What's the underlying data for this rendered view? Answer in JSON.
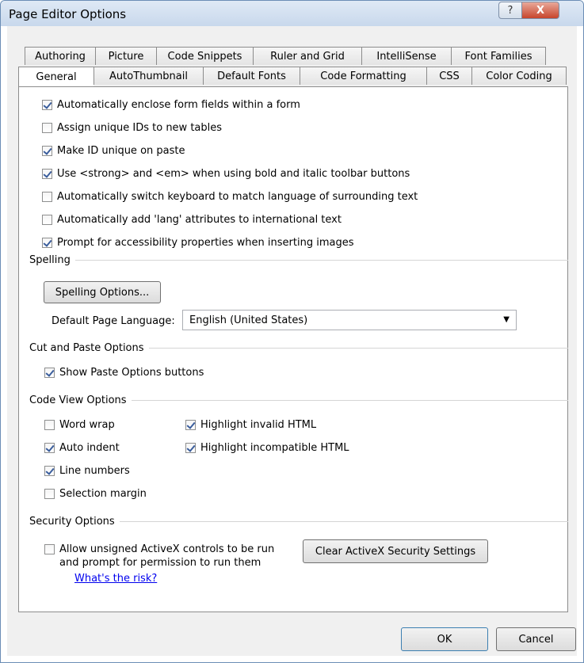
{
  "window": {
    "title": "Page Editor Options"
  },
  "titlebar": {
    "help_label": "?",
    "close_label": "X"
  },
  "tabs": {
    "row1": [
      "Authoring",
      "Picture",
      "Code Snippets",
      "Ruler and Grid",
      "IntelliSense",
      "Font Families"
    ],
    "row2": [
      "General",
      "AutoThumbnail",
      "Default Fonts",
      "Code Formatting",
      "CSS",
      "Color Coding"
    ],
    "active": "General"
  },
  "general": {
    "options": [
      {
        "label": "Automatically enclose form fields within a form",
        "checked": true
      },
      {
        "label": "Assign unique IDs to new tables",
        "checked": false
      },
      {
        "label": "Make ID unique on paste",
        "checked": true
      },
      {
        "label": "Use <strong> and <em> when using bold and italic toolbar buttons",
        "checked": true
      },
      {
        "label": "Automatically switch keyboard to match language of surrounding text",
        "checked": false
      },
      {
        "label": "Automatically add 'lang' attributes to international text",
        "checked": false
      },
      {
        "label": "Prompt for accessibility properties when inserting images",
        "checked": true
      }
    ]
  },
  "spelling": {
    "section_label": "Spelling",
    "options_button": "Spelling Options...",
    "language_label": "Default Page Language:",
    "language_value": "English (United States)"
  },
  "cut_paste": {
    "section_label": "Cut and Paste Options",
    "show_paste_label": "Show Paste Options buttons",
    "show_paste_checked": true
  },
  "code_view": {
    "section_label": "Code View Options",
    "word_wrap": {
      "label": "Word wrap",
      "checked": false
    },
    "auto_indent": {
      "label": "Auto indent",
      "checked": true
    },
    "line_numbers": {
      "label": "Line numbers",
      "checked": true
    },
    "selection_margin": {
      "label": "Selection margin",
      "checked": false
    },
    "highlight_invalid": {
      "label": "Highlight invalid HTML",
      "checked": true
    },
    "highlight_incompatible": {
      "label": "Highlight incompatible HTML",
      "checked": true
    }
  },
  "security": {
    "section_label": "Security Options",
    "activex_line1": "Allow unsigned ActiveX controls to be run",
    "activex_line2": "and prompt for permission to run them",
    "activex_checked": false,
    "clear_button": "Clear ActiveX Security Settings",
    "risk_link": "What's the risk?"
  },
  "footer": {
    "ok_label": "OK",
    "cancel_label": "Cancel"
  }
}
